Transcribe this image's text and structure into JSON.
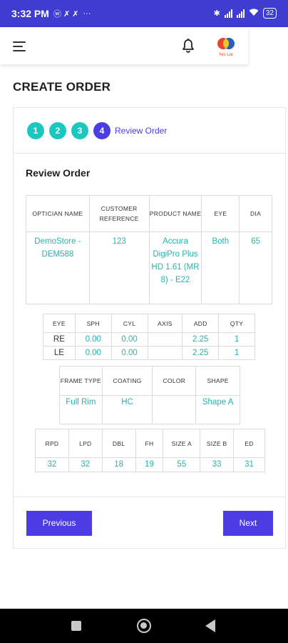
{
  "status_bar": {
    "time": "3:32 PM",
    "notification_icons": "ⓦ ✗ ✗",
    "dots": "···",
    "battery": "32"
  },
  "colors": {
    "status_bar": "#3f3dd0",
    "accent": "#4b3de3",
    "teal": "#1cc7c0",
    "value_text": "#27b3ae"
  },
  "header": {
    "logo_text": "Yes Lor"
  },
  "page": {
    "title": "CREATE ORDER"
  },
  "steps": {
    "items": [
      "1",
      "2",
      "3",
      "4"
    ],
    "current_label": "Review Order"
  },
  "review": {
    "title": "Review Order",
    "order_table": {
      "headers": [
        "OPTICIAN NAME",
        "CUSTOMER REFERENCE",
        "PRODUCT NAME",
        "EYE",
        "DIA"
      ],
      "row": [
        "DemoStore - DEM588",
        "123",
        "Accura DigiPro Plus HD 1.61 (MR 8) - E22",
        "Both",
        "65"
      ]
    },
    "power_table": {
      "headers": [
        "EYE",
        "SPH",
        "CYL",
        "AXIS",
        "ADD",
        "QTY"
      ],
      "rows": [
        [
          "RE",
          "0.00",
          "0.00",
          "",
          "2.25",
          "1"
        ],
        [
          "LE",
          "0.00",
          "0.00",
          "",
          "2.25",
          "1"
        ]
      ]
    },
    "frame_table": {
      "headers": [
        "FRAME TYPE",
        "COATING",
        "COLOR",
        "SHAPE"
      ],
      "row": [
        "Full Rim",
        "HC",
        "",
        "Shape A"
      ]
    },
    "measure_table": {
      "headers": [
        "RPD",
        "LPD",
        "DBL",
        "FH",
        "SIZE A",
        "SIZE B",
        "ED"
      ],
      "row": [
        "32",
        "32",
        "18",
        "19",
        "55",
        "33",
        "31"
      ]
    }
  },
  "buttons": {
    "previous": "Previous",
    "next": "Next"
  }
}
